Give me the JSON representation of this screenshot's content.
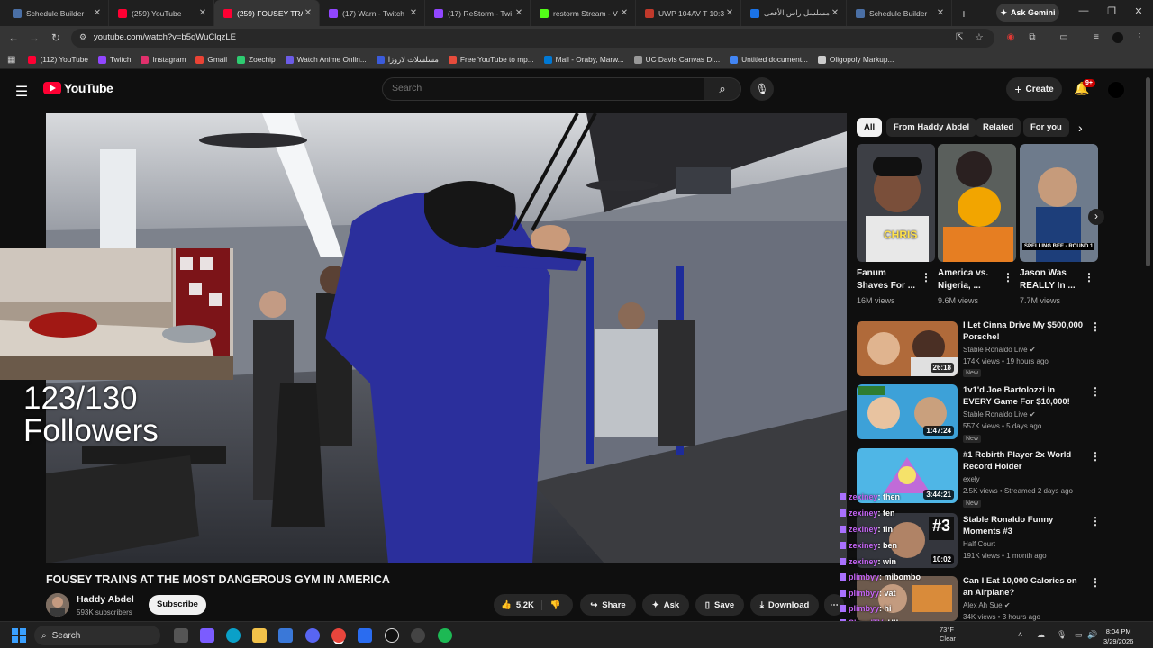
{
  "browser": {
    "tabs": [
      {
        "label": "Schedule Builder",
        "color": "#4a6fa5",
        "icon": "schedule-builder-favicon"
      },
      {
        "label": "(259) YouTube",
        "color": "#ff0033",
        "icon": "youtube-favicon"
      },
      {
        "label": "(259) FOUSEY TRAIN",
        "color": "#ff0033",
        "icon": "youtube-favicon",
        "active": true
      },
      {
        "label": "(17) Warn - Twitch",
        "color": "#9146ff",
        "icon": "twitch-favicon"
      },
      {
        "label": "(17) ReStorm - Twi",
        "color": "#9146ff",
        "icon": "twitch-favicon"
      },
      {
        "label": "restorm Stream - V",
        "color": "#53fc18",
        "icon": "kick-favicon"
      },
      {
        "label": "UWP 104AV T 10:3",
        "color": "#c0392b",
        "icon": "uwp-favicon"
      },
      {
        "label": "مسلسل راس الأفعى",
        "color": "#1a73e8",
        "icon": "video-favicon"
      },
      {
        "label": "Schedule Builder",
        "color": "#4a6fa5",
        "icon": "schedule-builder-favicon"
      }
    ],
    "ask_gemini": "Ask Gemini",
    "url": "youtube.com/watch?v=b5qWuClqzLE",
    "bookmarks": [
      {
        "label": "(112) YouTube",
        "color": "#ff0033"
      },
      {
        "label": "Twitch",
        "color": "#9146ff"
      },
      {
        "label": "Instagram",
        "color": "#e1306c"
      },
      {
        "label": "Gmail",
        "color": "#ea4335"
      },
      {
        "label": "Zoechip",
        "color": "#2ecc71"
      },
      {
        "label": "Watch Anime Onlin...",
        "color": "#6c5ce7"
      },
      {
        "label": "مسلسلات لاروزا",
        "color": "#3b5bdb"
      },
      {
        "label": "Free YouTube to mp...",
        "color": "#e74c3c"
      },
      {
        "label": "Mail - Oraby, Marw...",
        "color": "#0078d4"
      },
      {
        "label": "UC Davis Canvas Di...",
        "color": "#999999"
      },
      {
        "label": "Untitled document...",
        "color": "#4285f4"
      },
      {
        "label": "Oligopoly Markup...",
        "color": "#cccccc"
      }
    ]
  },
  "youtube": {
    "logo_text": "YouTube",
    "search_placeholder": "Search",
    "create_label": "Create",
    "notif_count": "9+",
    "overlay_followers_count": "123/130",
    "overlay_followers_label": "Followers",
    "video_title": "FOUSEY TRAINS AT THE MOST DANGEROUS GYM IN AMERICA",
    "channel_name": "Haddy Abdel",
    "channel_subs": "593K subscribers",
    "subscribe_label": "Subscribe",
    "like_count": "5.2K",
    "share_label": "Share",
    "ask_label": "Ask",
    "save_label": "Save",
    "download_label": "Download",
    "chips": [
      "All",
      "From Haddy Abdel",
      "Related",
      "For you"
    ],
    "shorts": [
      {
        "title": "Fanum Shaves For ...",
        "views": "16M views",
        "overlay": "CHRIS"
      },
      {
        "title": "America vs. Nigeria, ...",
        "views": "9.6M views",
        "overlay": ""
      },
      {
        "title": "Jason Was REALLY In ...",
        "views": "7.7M views",
        "overlay": "SPELLING BEE - ROUND 1"
      }
    ],
    "related": [
      {
        "title": "I Let Cinna Drive My $500,000 Porsche!",
        "channel": "Stable Ronaldo Live",
        "meta": "174K views • 19 hours ago",
        "badge": "New",
        "duration": "26:18"
      },
      {
        "title": "1v1'd Joe Bartolozzi In EVERY Game For $10,000!",
        "channel": "Stable Ronaldo Live",
        "meta": "557K views • 5 days ago",
        "badge": "New",
        "duration": "1:47:24"
      },
      {
        "title": "#1 Rebirth Player 2x World Record Holder",
        "channel": "exely",
        "meta": "2.5K views • Streamed 2 days ago",
        "badge": "New",
        "duration": "3:44:21"
      },
      {
        "title": "Stable Ronaldo Funny Moments #3",
        "channel": "Half Court",
        "meta": "191K views • 1 month ago",
        "badge": "",
        "duration": "10:02"
      },
      {
        "title": "Can I Eat 10,000 Calories on an Airplane?",
        "channel": "Alex Ah Sue",
        "meta": "34K views • 3 hours ago",
        "badge": "",
        "duration": ""
      }
    ],
    "chat": [
      {
        "user": "zexiney",
        "msg": ": then"
      },
      {
        "user": "zexiney",
        "msg": ": ten"
      },
      {
        "user": "zexiney",
        "msg": ": fin"
      },
      {
        "user": "zexiney",
        "msg": ": ben"
      },
      {
        "user": "zexiney",
        "msg": ": win"
      },
      {
        "user": "plimbyy",
        "msg": ": mibombo"
      },
      {
        "user": "plimbyy",
        "msg": ": vat"
      },
      {
        "user": "plimbyy",
        "msg": ": hi"
      },
      {
        "user": "ShaydTV",
        "msg": ": HI!"
      },
      {
        "user": "koooom1c",
        "msg": ": hi"
      }
    ]
  },
  "taskbar": {
    "search_label": "Search",
    "weather_temp": "73°F",
    "weather_desc": "Clear",
    "time": "8:04 PM",
    "date": "3/29/2026"
  }
}
